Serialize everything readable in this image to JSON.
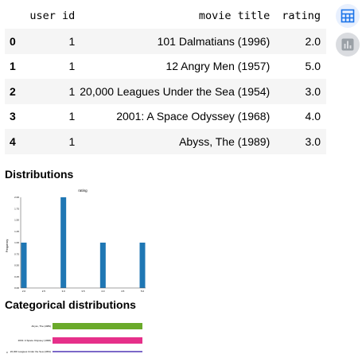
{
  "table": {
    "columns": [
      "",
      "user id",
      "movie title",
      "rating"
    ],
    "rows": [
      {
        "index": "0",
        "user_id": "1",
        "title": "101 Dalmatians (1996)",
        "rating": "2.0"
      },
      {
        "index": "1",
        "user_id": "1",
        "title": "12 Angry Men (1957)",
        "rating": "5.0"
      },
      {
        "index": "2",
        "user_id": "1",
        "title": "20,000 Leagues Under the Sea (1954)",
        "rating": "3.0"
      },
      {
        "index": "3",
        "user_id": "1",
        "title": "2001: A Space Odyssey (1968)",
        "rating": "4.0"
      },
      {
        "index": "4",
        "user_id": "1",
        "title": "Abyss, The (1989)",
        "rating": "3.0"
      }
    ]
  },
  "side_buttons": {
    "table_icon": "table-icon",
    "chart_icon": "bar-chart-icon",
    "accent": "#1a73e8",
    "muted": "#9aa0a6"
  },
  "sections": {
    "distributions": "Distributions",
    "categorical": "Categorical distributions"
  },
  "chart_data": [
    {
      "type": "bar",
      "title": "rating",
      "xlabel": "",
      "ylabel": "Frequency",
      "x": [
        2.0,
        3.0,
        4.0,
        5.0
      ],
      "values": [
        1,
        2,
        1,
        1
      ],
      "xlim": [
        2.0,
        5.0
      ],
      "ylim": [
        0,
        2.0
      ],
      "xticks": [
        "2.0",
        "2.5",
        "3.0",
        "3.5",
        "4.0",
        "4.5",
        "5.0"
      ],
      "yticks": [
        "0.00",
        "0.25",
        "0.50",
        "0.75",
        "1.00",
        "1.25",
        "1.50",
        "1.75",
        "2.00"
      ],
      "color": "#1f77b4"
    },
    {
      "type": "bar",
      "orientation": "horizontal",
      "categories": [
        "Abyss, The (1989)",
        "2001: A Space Odyssey (1968)",
        "20,000 Leagues Under the Sea (1954)"
      ],
      "values": [
        1,
        1,
        1
      ],
      "colors": [
        "#6aaa2a",
        "#e6308a",
        "#7b68c8"
      ],
      "yticks": [
        "0"
      ]
    }
  ]
}
